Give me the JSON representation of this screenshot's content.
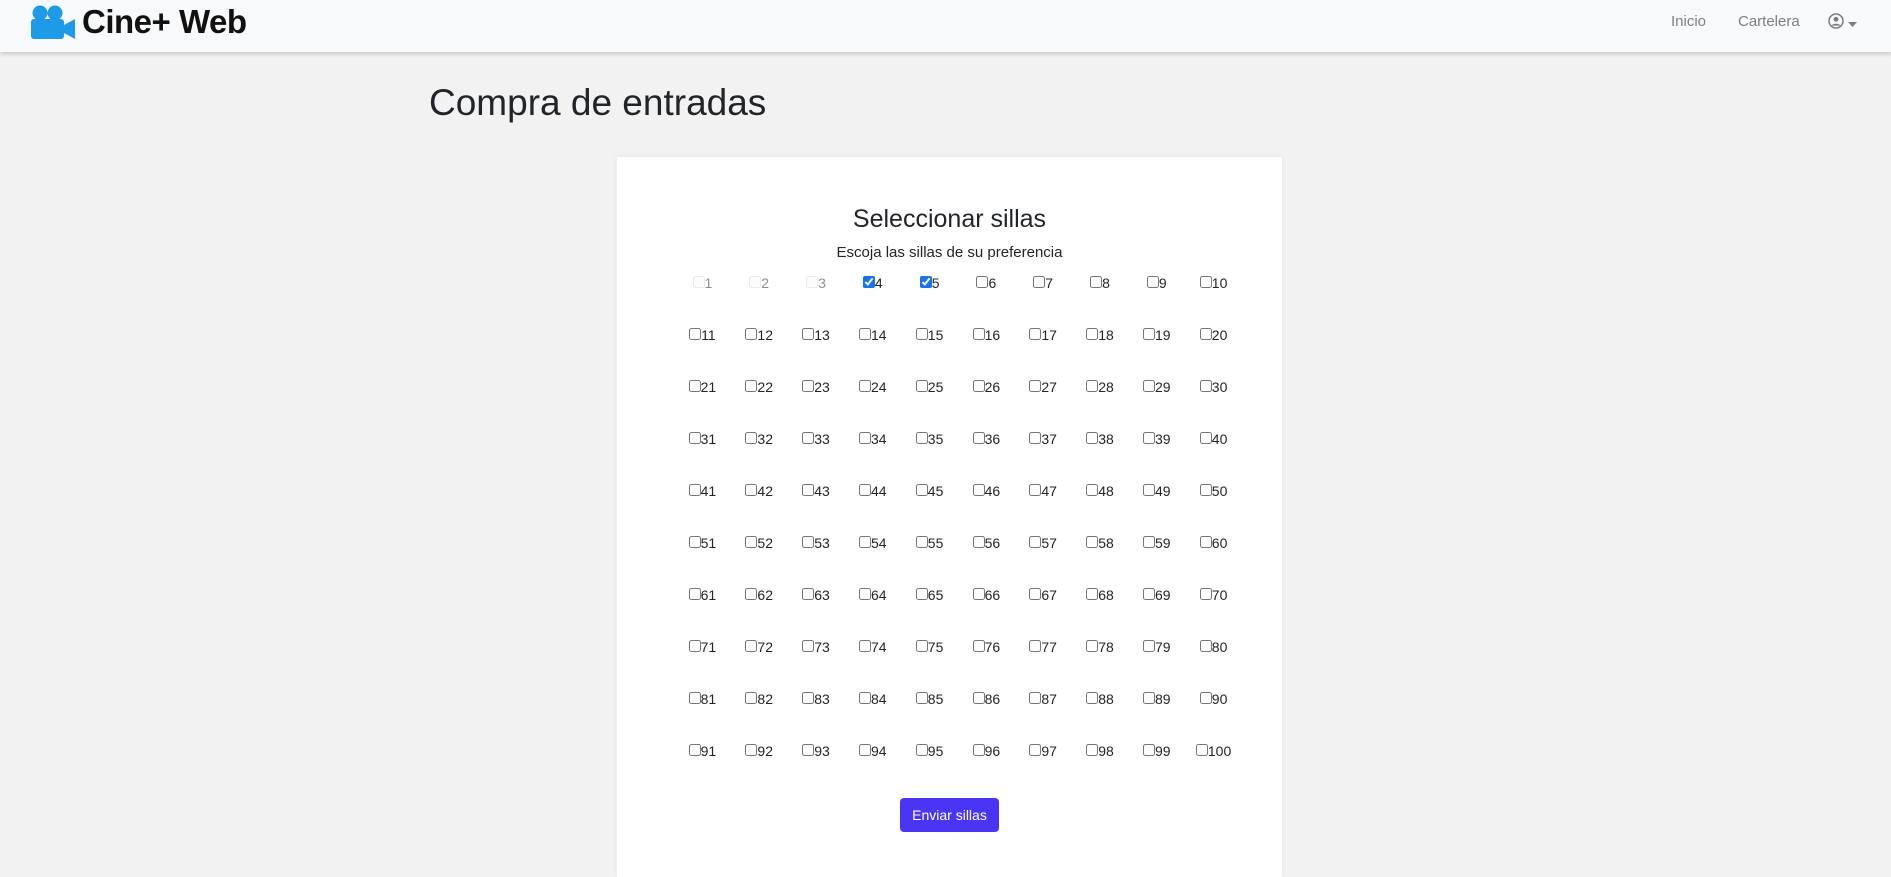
{
  "app": {
    "brand_name": "Cine+ Web",
    "logo_icon": "video-camera-icon",
    "accent_color": "#1e9be6"
  },
  "nav": {
    "links": [
      {
        "label": "Inicio"
      },
      {
        "label": "Cartelera"
      }
    ],
    "user_icon": "user-circle-icon",
    "dropdown_icon": "caret-down-icon"
  },
  "page": {
    "title": "Compra de entradas"
  },
  "seat_card": {
    "title": "Seleccionar sillas",
    "subtitle": "Escoja las sillas de su preferencia",
    "disabled_seats": [
      1,
      2,
      3
    ],
    "checked_seats": [
      4,
      5
    ],
    "seat_count": 100,
    "submit_label": "Enviar sillas",
    "submit_color": "#4b35f5"
  }
}
